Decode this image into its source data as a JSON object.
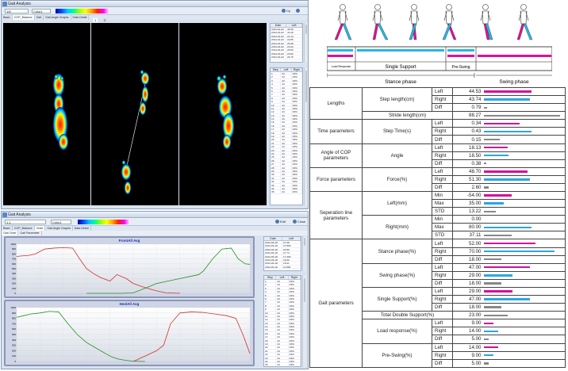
{
  "top_window": {
    "title": "Gait Analysis",
    "toolbar": {
      "input_value": "1/8",
      "combo_value": "Color1",
      "btn_cp": "Cp",
      "btn_close": "Close"
    },
    "tabs": [
      "Basic",
      "COP_Balance",
      "Gait",
      "Gait Angle Graphs",
      "Data Detail"
    ],
    "inner_tabs": [
      "1",
      "2"
    ],
    "table1": {
      "headers": [
        "Date",
        "Left"
      ],
      "rows": [
        [
          "2014-01-02",
          "45.30"
        ],
        [
          "2014-01-02",
          "43.18"
        ],
        [
          "2014-01-02",
          "22.14"
        ],
        [
          "2014-01-02",
          "22.85"
        ],
        [
          "2014-01-02",
          "25.48"
        ],
        [
          "2014-01-02",
          "23.22"
        ],
        [
          "2014-01-02",
          "25.00"
        ],
        [
          "2014-01-02",
          "23.62"
        ],
        [
          "2014-01-02",
          "26.70"
        ]
      ]
    },
    "table2": {
      "headers": [
        "Step",
        "Left",
        "Right"
      ],
      "rows": [
        [
          "1",
          "24",
          "33%"
        ],
        [
          "2",
          "24",
          "33%"
        ],
        [
          "3",
          "24",
          "33%"
        ],
        [
          "4",
          "24",
          "33%"
        ],
        [
          "5",
          "24",
          "33%"
        ],
        [
          "6",
          "24",
          "33%"
        ],
        [
          "7",
          "24",
          "33%"
        ],
        [
          "8",
          "24",
          "33%"
        ],
        [
          "9",
          "24",
          "33%"
        ],
        [
          "10",
          "24",
          "33%"
        ],
        [
          "11",
          "24",
          "33%"
        ],
        [
          "12",
          "24",
          "33%"
        ],
        [
          "13",
          "24",
          "33%"
        ],
        [
          "14",
          "24",
          "33%"
        ],
        [
          "15",
          "24",
          "33%"
        ],
        [
          "16",
          "24",
          "33%"
        ],
        [
          "17",
          "24",
          "33%"
        ],
        [
          "18",
          "24",
          "33%"
        ],
        [
          "19",
          "24",
          "33%"
        ],
        [
          "20",
          "24",
          "33%"
        ],
        [
          "21",
          "24",
          "33%"
        ],
        [
          "22",
          "24",
          "33%"
        ],
        [
          "23",
          "24",
          "33%"
        ],
        [
          "24",
          "24",
          "33%"
        ],
        [
          "25",
          "24",
          "33%"
        ],
        [
          "26",
          "24",
          "33%"
        ],
        [
          "27",
          "24",
          "33%"
        ],
        [
          "28",
          "24",
          "33%"
        ],
        [
          "29",
          "24",
          "33%"
        ],
        [
          "30",
          "24",
          "33%"
        ],
        [
          "31",
          "24",
          "33%"
        ],
        [
          "32",
          "24",
          "33%"
        ],
        [
          "33",
          "24",
          "33%"
        ],
        [
          "34",
          "24",
          "33%"
        ],
        [
          "35",
          "24",
          "33%"
        ]
      ]
    }
  },
  "bottom_window": {
    "title": "Gait Analysis",
    "toolbar": {
      "input_value": "1-1",
      "combo_value": "Color1",
      "btn_edit": "Edit",
      "btn_close": "Close"
    },
    "tabs": [
      "Basic",
      "COP_Balance",
      "Chart",
      "Gait Angle Graphs",
      "Data Detail"
    ],
    "sub_tabs": [
      "Gait Chart",
      "Gait Parameter"
    ],
    "table1": {
      "headers": [
        "Date",
        "Left"
      ],
      "rows": [
        [
          "2014-03-18",
          "27.38"
        ],
        [
          "2014-03-18",
          "27.860"
        ],
        [
          "2014-03-18",
          "24.80"
        ],
        [
          "2014-03-18",
          "27.73"
        ],
        [
          "2014-03-18",
          "17.360"
        ],
        [
          "2014-03-18",
          "16.60"
        ],
        [
          "2014-03-18",
          "18.41"
        ],
        [
          "2014-03-18",
          "11.800"
        ]
      ]
    },
    "table2": {
      "headers": [
        "Step",
        "Left",
        "Right"
      ],
      "rows": [
        [
          "1",
          "24",
          "33%"
        ],
        [
          "2",
          "24",
          "33%"
        ],
        [
          "3",
          "24",
          "33%"
        ],
        [
          "4",
          "24",
          "33%"
        ],
        [
          "5",
          "24",
          "33%"
        ],
        [
          "6",
          "24",
          "33%"
        ],
        [
          "7",
          "24",
          "33%"
        ],
        [
          "8",
          "24",
          "33%"
        ],
        [
          "9",
          "24",
          "33%"
        ],
        [
          "10",
          "24",
          "33%"
        ],
        [
          "11",
          "24",
          "33%"
        ],
        [
          "12",
          "24",
          "33%"
        ],
        [
          "13",
          "24",
          "33%"
        ],
        [
          "14",
          "24",
          "33%"
        ],
        [
          "15",
          "24",
          "33%"
        ],
        [
          "16",
          "24",
          "33%"
        ],
        [
          "17",
          "24",
          "33%"
        ],
        [
          "18",
          "24",
          "33%"
        ],
        [
          "19",
          "24",
          "33%"
        ],
        [
          "20",
          "24",
          "33%"
        ],
        [
          "21",
          "24",
          "33%"
        ],
        [
          "22",
          "24",
          "33%"
        ],
        [
          "23",
          "24",
          "33%"
        ],
        [
          "24",
          "24",
          "33%"
        ],
        [
          "25",
          "24",
          "33%"
        ],
        [
          "26",
          "24",
          "33%"
        ]
      ]
    }
  },
  "chart_data": [
    {
      "type": "line",
      "title": "FrontAll Avg",
      "ylim": [
        0,
        1000
      ],
      "xlim": [
        0,
        100
      ],
      "series": [
        {
          "color": "#d03030",
          "x": [
            0,
            2,
            5,
            8,
            12,
            16,
            20,
            24,
            27,
            30,
            33,
            36,
            40,
            43,
            47,
            50,
            53,
            56,
            60,
            64,
            70
          ],
          "y": [
            750,
            760,
            770,
            800,
            900,
            920,
            930,
            920,
            700,
            500,
            400,
            320,
            250,
            380,
            300,
            200,
            150,
            100,
            50,
            10,
            0
          ]
        },
        {
          "color": "#209020",
          "x": [
            30,
            35,
            40,
            45,
            50,
            55,
            60,
            65,
            70,
            75,
            78,
            80,
            84,
            88,
            92,
            95,
            98,
            100
          ],
          "y": [
            0,
            0,
            0,
            0,
            10,
            100,
            200,
            250,
            300,
            350,
            380,
            450,
            700,
            900,
            920,
            700,
            600,
            590
          ]
        }
      ]
    },
    {
      "type": "line",
      "title": "HeelAll Avg",
      "ylim": [
        0,
        1000
      ],
      "xlim": [
        0,
        100
      ],
      "series": [
        {
          "color": "#209020",
          "x": [
            0,
            3,
            6,
            10,
            14,
            18,
            22,
            26,
            30,
            34,
            38,
            41,
            44,
            47,
            50,
            55
          ],
          "y": [
            820,
            850,
            880,
            900,
            930,
            920,
            700,
            500,
            350,
            250,
            150,
            80,
            40,
            20,
            5,
            0
          ]
        },
        {
          "color": "#d03030",
          "x": [
            50,
            55,
            60,
            63,
            66,
            70,
            75,
            80,
            85,
            90,
            94,
            97,
            100
          ],
          "y": [
            0,
            100,
            200,
            300,
            700,
            900,
            920,
            910,
            880,
            850,
            800,
            500,
            150
          ]
        }
      ]
    }
  ],
  "phase_diagram": {
    "stance_label": "Stance phase",
    "swing_label": "Swing phase",
    "single_support": "Single Support",
    "load_response": "Load Response",
    "pre_swing": "Pre-Swing",
    "colors": {
      "left": "#e0109a",
      "right": "#20b8e8"
    }
  },
  "params": {
    "rows": [
      {
        "cat": "Lengths",
        "sub": "Step length(cm)",
        "side": "Left",
        "value": "44.53",
        "frac": 0.6,
        "color": "#d40c9c"
      },
      {
        "sub": "",
        "side": "Right",
        "value": "43.74",
        "frac": 0.58,
        "color": "#2aa7e0"
      },
      {
        "sub": "",
        "side": "Diff",
        "value": "0.79",
        "frac": 0.04,
        "color": "#888888"
      },
      {
        "sub": "Stride length(cm)",
        "side": "",
        "value": "88.27",
        "frac": 0.95,
        "color": "#888888"
      },
      {
        "cat": "Time parameters",
        "sub": "Step Time(s)",
        "side": "Left",
        "value": "0.34",
        "frac": 0.45,
        "color": "#d40c9c"
      },
      {
        "sub": "",
        "side": "Right",
        "value": "0.43",
        "frac": 0.6,
        "color": "#2aa7e0"
      },
      {
        "sub": "",
        "side": "Diff",
        "value": "0.15",
        "frac": 0.2,
        "color": "#888888"
      },
      {
        "cat": "Angle of COP parameters",
        "sub": "Angle",
        "side": "Left",
        "value": "18.13",
        "frac": 0.3,
        "color": "#d40c9c"
      },
      {
        "sub": "",
        "side": "Right",
        "value": "18.50",
        "frac": 0.31,
        "color": "#2aa7e0"
      },
      {
        "sub": "",
        "side": "Diff",
        "value": "0.38",
        "frac": 0.03,
        "color": "#888888"
      },
      {
        "cat": "Force parameters",
        "sub": "Force(%)",
        "side": "Left",
        "value": "48.70",
        "frac": 0.55,
        "color": "#d40c9c"
      },
      {
        "sub": "",
        "side": "Right",
        "value": "51.30",
        "frac": 0.58,
        "color": "#2aa7e0"
      },
      {
        "sub": "",
        "side": "Diff",
        "value": "2.60",
        "frac": 0.06,
        "color": "#888888"
      },
      {
        "cat": "Seperation line parameters",
        "sub": "Left(mm)",
        "side": "Min",
        "value": "-54.00",
        "frac": 0.35,
        "color": "#d40c9c"
      },
      {
        "sub": "",
        "side": "Max",
        "value": "35.00",
        "frac": 0.25,
        "color": "#2aa7e0"
      },
      {
        "sub": "",
        "side": "STD",
        "value": "13.22",
        "frac": 0.15,
        "color": "#888888"
      },
      {
        "sub": "Right(mm)",
        "side": "Min",
        "value": "0.00",
        "frac": 0.0,
        "color": "#d40c9c"
      },
      {
        "sub": "",
        "side": "Max",
        "value": "80.00",
        "frac": 0.6,
        "color": "#2aa7e0"
      },
      {
        "sub": "",
        "side": "STD",
        "value": "37.11",
        "frac": 0.35,
        "color": "#888888"
      },
      {
        "cat": "Gait parameters",
        "sub": "Stance phase(%)",
        "side": "Left",
        "value": "52.00",
        "frac": 0.65,
        "color": "#d40c9c"
      },
      {
        "sub": "",
        "side": "Right",
        "value": "70.00",
        "frac": 0.88,
        "color": "#2aa7e0"
      },
      {
        "sub": "",
        "side": "Diff",
        "value": "18.00",
        "frac": 0.22,
        "color": "#888888"
      },
      {
        "sub": "Swing phase(%)",
        "side": "Left",
        "value": "47.00",
        "frac": 0.58,
        "color": "#d40c9c"
      },
      {
        "sub": "",
        "side": "Right",
        "value": "29.00",
        "frac": 0.36,
        "color": "#2aa7e0"
      },
      {
        "sub": "",
        "side": "Diff",
        "value": "18.00",
        "frac": 0.22,
        "color": "#888888"
      },
      {
        "sub": "Single Support(%)",
        "side": "Left",
        "value": "29.00",
        "frac": 0.36,
        "color": "#d40c9c"
      },
      {
        "sub": "",
        "side": "Right",
        "value": "47.00",
        "frac": 0.58,
        "color": "#2aa7e0"
      },
      {
        "sub": "",
        "side": "Diff",
        "value": "18.00",
        "frac": 0.22,
        "color": "#888888"
      },
      {
        "sub": "Total Double Support(%)",
        "side": "",
        "value": "23.00",
        "frac": 0.3,
        "color": "#888888"
      },
      {
        "sub": "Load response(%)",
        "side": "Left",
        "value": "9.00",
        "frac": 0.12,
        "color": "#d40c9c"
      },
      {
        "sub": "",
        "side": "Right",
        "value": "14.00",
        "frac": 0.18,
        "color": "#2aa7e0"
      },
      {
        "sub": "",
        "side": "Diff",
        "value": "5.00",
        "frac": 0.06,
        "color": "#888888"
      },
      {
        "sub": "Pre-Swing(%)",
        "side": "Left",
        "value": "14.00",
        "frac": 0.18,
        "color": "#d40c9c"
      },
      {
        "sub": "",
        "side": "Right",
        "value": "9.00",
        "frac": 0.12,
        "color": "#2aa7e0"
      },
      {
        "sub": "",
        "side": "Diff",
        "value": "5.00",
        "frac": 0.06,
        "color": "#888888"
      }
    ]
  }
}
